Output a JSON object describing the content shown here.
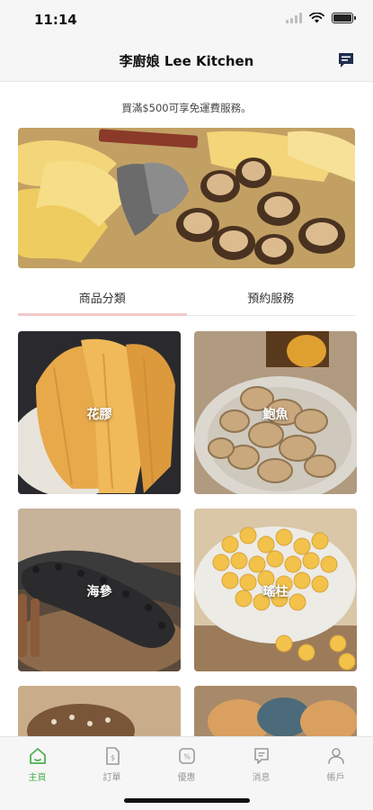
{
  "status": {
    "time": "11:14"
  },
  "header": {
    "title": "李廚娘 Lee Kitchen"
  },
  "notice": "買滿$500可享免運費服務。",
  "tabs": [
    {
      "label": "商品分類",
      "active": true
    },
    {
      "label": "預約服務",
      "active": false
    }
  ],
  "categories": [
    {
      "label": "花膠"
    },
    {
      "label": "鮑魚"
    },
    {
      "label": "海參"
    },
    {
      "label": "瑤柱"
    }
  ],
  "tabbar": [
    {
      "label": "主頁",
      "icon": "home-icon",
      "active": true
    },
    {
      "label": "訂單",
      "icon": "order-icon",
      "active": false
    },
    {
      "label": "優惠",
      "icon": "coupon-icon",
      "active": false
    },
    {
      "label": "消息",
      "icon": "message-icon",
      "active": false
    },
    {
      "label": "帳戶",
      "icon": "account-icon",
      "active": false
    }
  ],
  "colors": {
    "accent": "#4caf50",
    "tab_underline": "#f3c9c9",
    "navy": "#1f2d4d"
  }
}
